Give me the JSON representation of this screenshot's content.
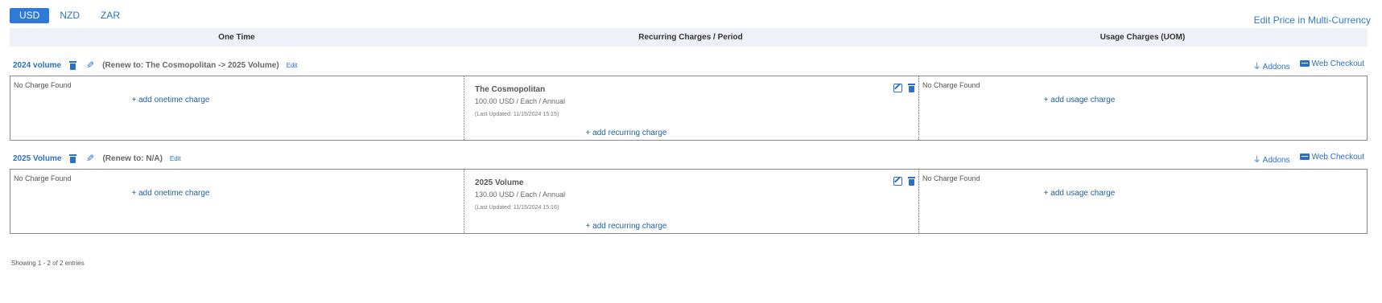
{
  "currency_tabs": [
    "USD",
    "NZD",
    "ZAR"
  ],
  "edit_multi_currency": "Edit Price in Multi-Currency",
  "columns": [
    "One Time",
    "Recurring Charges / Period",
    "Usage Charges (UOM)"
  ],
  "plans": [
    {
      "name": "2024 volume",
      "renew": "(Renew to: The Cosmopolitan -> 2025 Volume)",
      "edit": "Edit",
      "addons": "Addons",
      "web_checkout": "Web Checkout",
      "onetime_empty": "No Charge Found",
      "add_onetime": "+ add onetime charge",
      "charge_title": "The Cosmopolitan",
      "charge_price": "100.00 USD / Each / Annual",
      "charge_updated": "(Last Updated: 11/15/2024 15:15)",
      "add_recurring": "+ add recurring charge",
      "usage_empty": "No Charge Found",
      "add_usage": "+ add usage charge"
    },
    {
      "name": "2025 Volume",
      "renew": "(Renew to: N/A)",
      "edit": "Edit",
      "addons": "Addons",
      "web_checkout": "Web Checkout",
      "onetime_empty": "No Charge Found",
      "add_onetime": "+ add onetime charge",
      "charge_title": "2025 Volume",
      "charge_price": "130.00 USD / Each / Annual",
      "charge_updated": "(Last Updated: 11/15/2024 15:16)",
      "add_recurring": "+ add recurring charge",
      "usage_empty": "No Charge Found",
      "add_usage": "+ add usage charge"
    }
  ],
  "footer": "Showing 1 - 2 of 2 entries",
  "icons": {
    "delete": "trash-icon",
    "edit": "pencil-icon",
    "addons": "plug-icon",
    "web_checkout": "credit-card-icon",
    "edit_charge": "edit-square-icon"
  },
  "colors": {
    "accent": "#2f7ad6",
    "link": "#1f5e9e",
    "header_bg": "#eef2f8"
  }
}
